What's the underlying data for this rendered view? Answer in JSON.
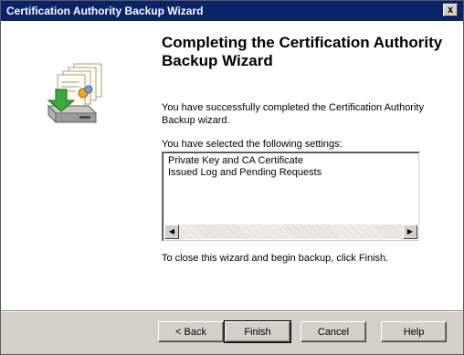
{
  "window": {
    "title": "Certification Authority Backup Wizard",
    "close_label": "x"
  },
  "page": {
    "title": "Completing the Certification Authority Backup Wizard",
    "completed_text": "You have successfully completed the Certification Authority Backup wizard.",
    "settings_label": "You have selected the following settings:",
    "settings_items": [
      "Private Key and CA Certificate",
      "Issued Log and Pending Requests"
    ],
    "instruction_text": "To close this wizard and begin backup, click Finish."
  },
  "buttons": {
    "back": "< Back",
    "finish": "Finish",
    "cancel": "Cancel",
    "help": "Help"
  },
  "icons": {
    "wizard_graphic": "certificate-backup-icon",
    "scroll_left": "arrow-left-icon",
    "scroll_right": "arrow-right-icon"
  }
}
